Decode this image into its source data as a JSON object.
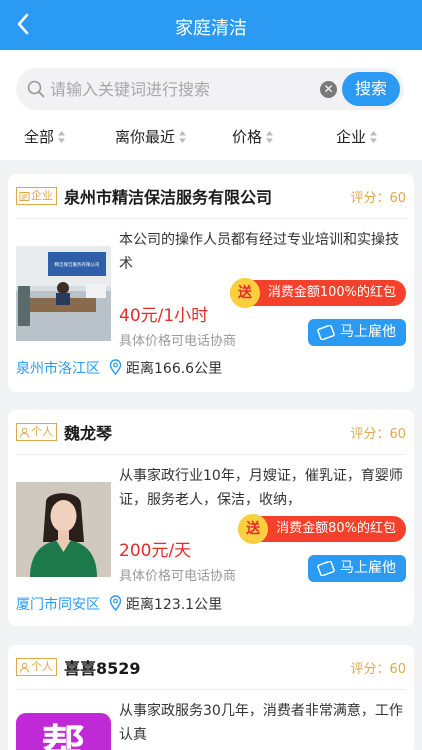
{
  "header": {
    "title": "家庭清洁"
  },
  "search": {
    "placeholder": "请输入关键词进行搜索",
    "button_label": "搜索"
  },
  "filters": [
    "全部",
    "离你最近",
    "价格",
    "企业"
  ],
  "listings": [
    {
      "tag": "企业",
      "name": "泉州市精洁保洁服务有限公司",
      "score": "评分：60",
      "description": "本公司的操作人员都有经过专业培训和实操技术",
      "price": "40元/1小时",
      "note": "具体价格可电话协商",
      "redpack_send": "送",
      "redpack": "消费金额100%的红包",
      "hire": "马上雇他",
      "location": "泉州市洛江区",
      "distance": "距离166.6公里",
      "photo_sign": "精洁保洁服务有限公司"
    },
    {
      "tag": "个人",
      "name": "魏龙琴",
      "score": "评分：60",
      "description": "从事家政行业10年，月嫂证，催乳证，育婴师证，服务老人，保洁，收纳，",
      "price": "200元/天",
      "note": "具体价格可电话协商",
      "redpack_send": "送",
      "redpack": "消费金额80%的红包",
      "hire": "马上雇他",
      "location": "厦门市同安区",
      "distance": "距离123.1公里"
    },
    {
      "tag": "个人",
      "name": "喜喜8529",
      "score": "评分：60",
      "description": "从事家政服务30几年，消费者非常满意，工作认真",
      "photo_text": "帮"
    }
  ],
  "colors": {
    "primary": "#2b9af3",
    "price": "#e52b2b",
    "tag": "#e0a84d",
    "redpack": "#f4412c"
  }
}
